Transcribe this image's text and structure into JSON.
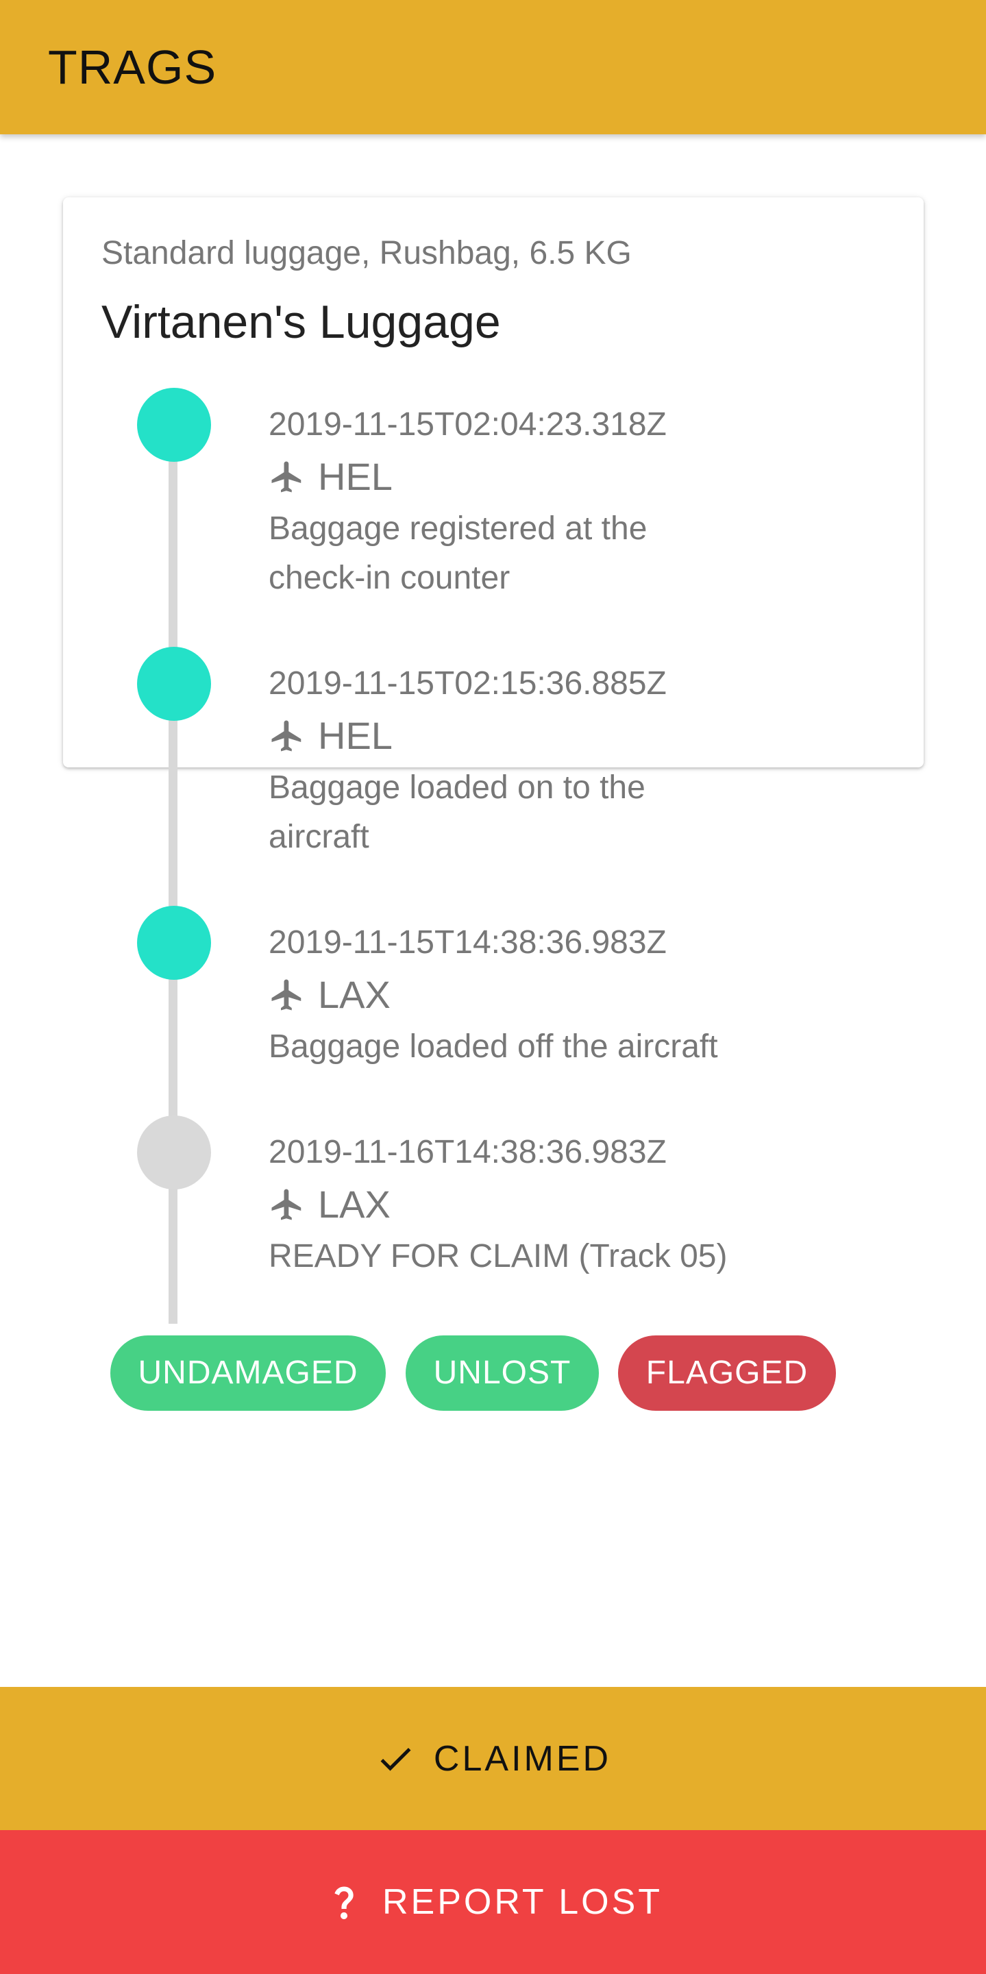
{
  "app_bar": {
    "title": "TRAGS"
  },
  "luggage": {
    "subtitle": "Standard luggage, Rushbag, 6.5 KG",
    "title": "Virtanen's Luggage"
  },
  "timeline": [
    {
      "timestamp": "2019-11-15T02:04:23.318Z",
      "location": "HEL",
      "description": "Baggage registered at the check-in counter",
      "status": "done",
      "icon": "airplane-icon"
    },
    {
      "timestamp": "2019-11-15T02:15:36.885Z",
      "location": "HEL",
      "description": "Baggage loaded on to the aircraft",
      "status": "done",
      "icon": "airplane-icon"
    },
    {
      "timestamp": "2019-11-15T14:38:36.983Z",
      "location": "LAX",
      "description": "Baggage loaded off the aircraft",
      "status": "done",
      "icon": "airplane-icon"
    },
    {
      "timestamp": "2019-11-16T14:38:36.983Z",
      "location": "LAX",
      "description": "READY FOR CLAIM (Track 05)",
      "status": "pending",
      "icon": "airplane-icon"
    }
  ],
  "chips": [
    {
      "label": "UNDAMAGED",
      "color": "#47d185"
    },
    {
      "label": "UNLOST",
      "color": "#47d185"
    },
    {
      "label": "FLAGGED",
      "color": "#d4464f"
    }
  ],
  "actions": {
    "claimed": {
      "label": "CLAIMED",
      "icon": "check-icon",
      "color": "#e5ae2b"
    },
    "report_lost": {
      "label": "REPORT LOST",
      "icon": "question-mark-icon",
      "color": "#f04142"
    }
  },
  "colors": {
    "brand": "#e5ae2b",
    "timeline_done": "#24e1c8",
    "timeline_pending": "#d9d9d9"
  }
}
